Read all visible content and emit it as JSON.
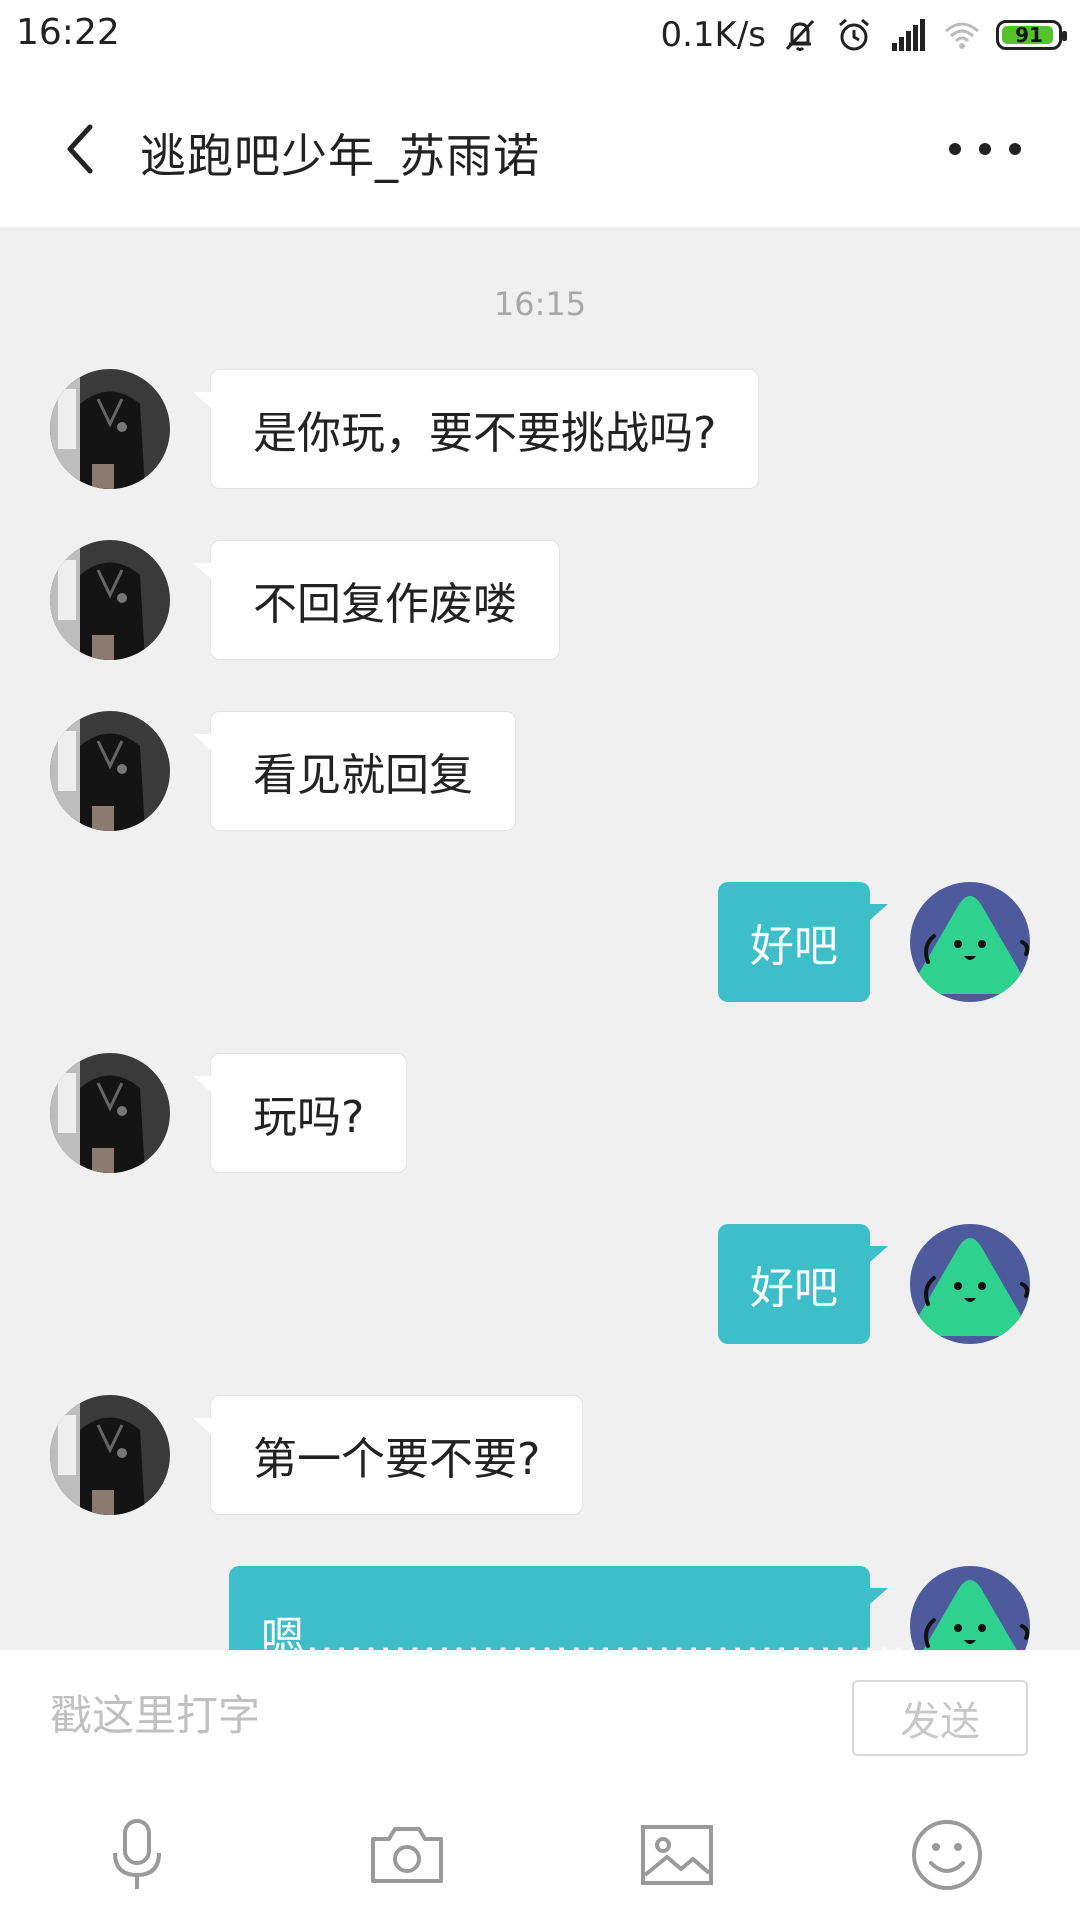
{
  "status_bar": {
    "time": "16:22",
    "net_speed": "0.1K/s",
    "battery": "91",
    "icons": [
      "mute-bell-icon",
      "alarm-icon",
      "signal-icon",
      "wifi-icon",
      "battery-icon"
    ]
  },
  "header": {
    "title": "逃跑吧少年_苏雨诺",
    "back_icon": "chevron-left-icon",
    "more_icon": "more-dots-icon"
  },
  "chat": {
    "timestamp": "16:15",
    "messages": [
      {
        "side": "in",
        "text": "是你玩，要不要挑战吗?"
      },
      {
        "side": "in",
        "text": "不回复作废喽"
      },
      {
        "side": "in",
        "text": "看见就回复"
      },
      {
        "side": "out",
        "text": "好吧"
      },
      {
        "side": "in",
        "text": "玩吗?"
      },
      {
        "side": "out",
        "text": "好吧"
      },
      {
        "side": "in",
        "text": "第一个要不要?"
      },
      {
        "side": "out",
        "text": "嗯………………………………………"
      }
    ]
  },
  "input": {
    "placeholder": "戳这里打字",
    "value": "",
    "send_label": "发送"
  },
  "toolbar": {
    "items": [
      "microphone-icon",
      "camera-icon",
      "image-icon",
      "emoji-icon"
    ]
  },
  "colors": {
    "accent": "#3dbec9",
    "background": "#f0f0f0",
    "battery": "#55c22a"
  }
}
